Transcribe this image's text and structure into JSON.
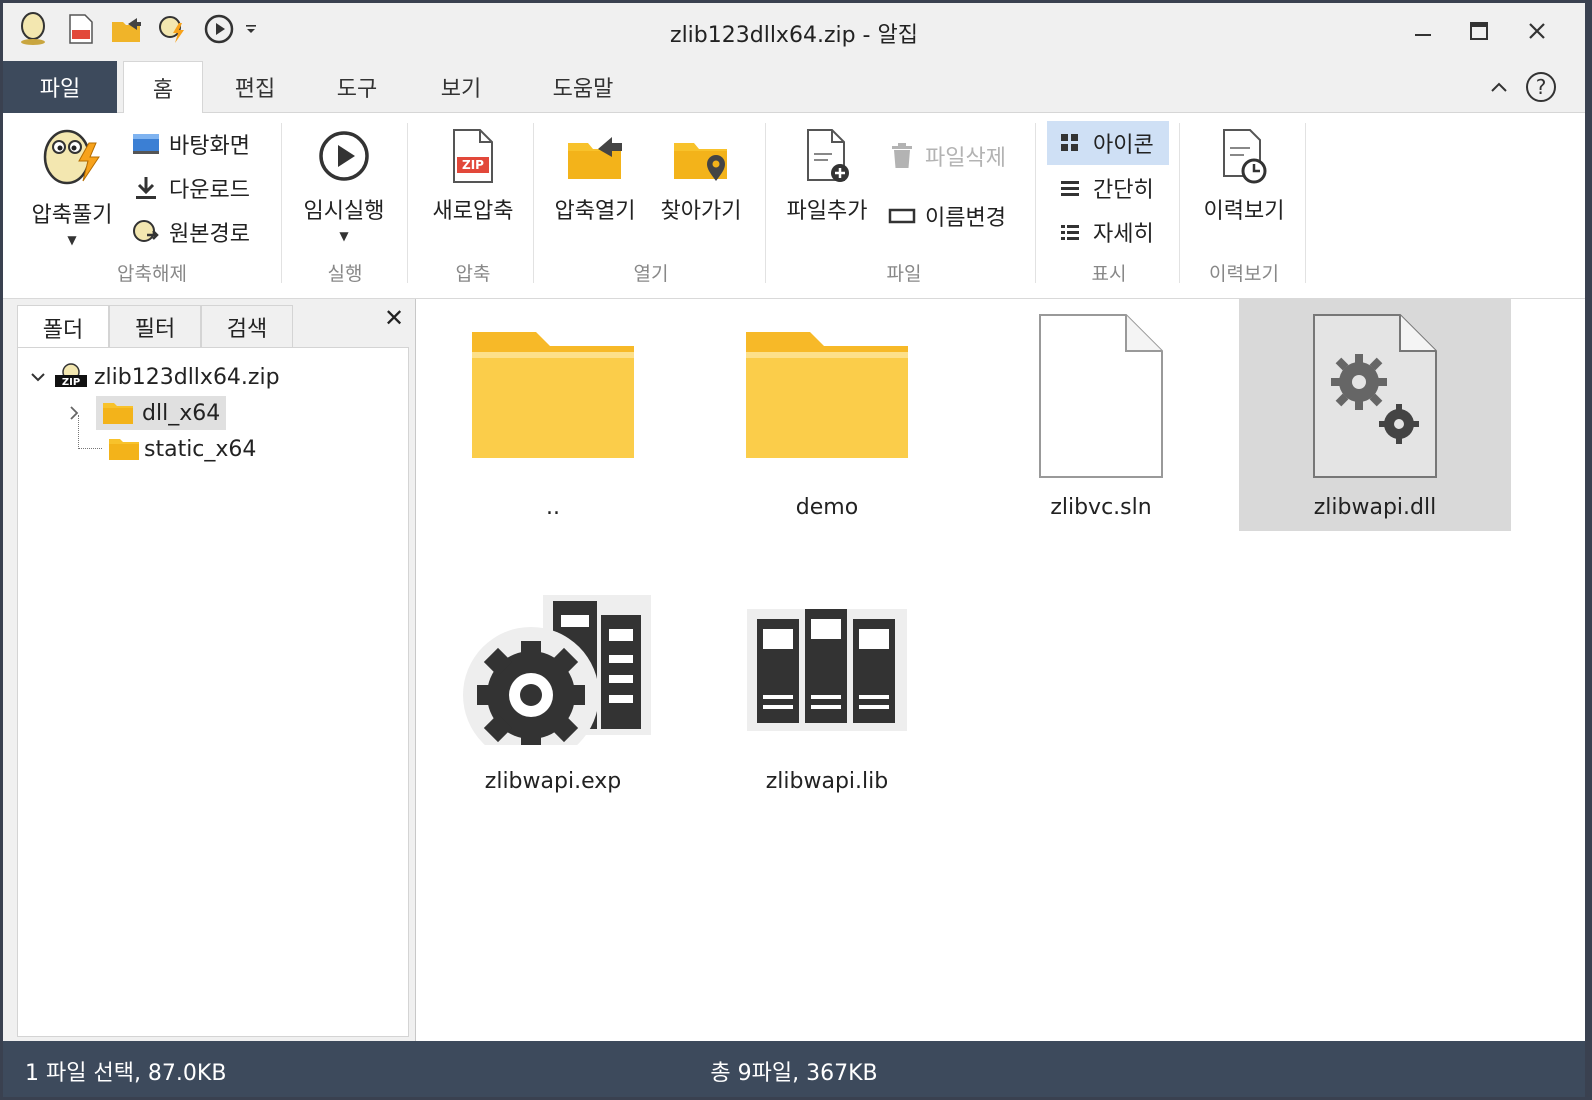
{
  "window": {
    "title": "zlib123dllx64.zip - 알집"
  },
  "tabs": [
    {
      "label": "파일"
    },
    {
      "label": "홈"
    },
    {
      "label": "편집"
    },
    {
      "label": "도구"
    },
    {
      "label": "보기"
    },
    {
      "label": "도움말"
    }
  ],
  "ribbon": {
    "extract": {
      "big": "압축풀기",
      "desktop": "바탕화면",
      "download": "다운로드",
      "origin": "원본경로",
      "group": "압축해제"
    },
    "run": {
      "big": "임시실행",
      "group": "실행"
    },
    "compress": {
      "big": "새로압축",
      "group": "압축"
    },
    "open": {
      "open_label": "압축열기",
      "find_label": "찾아가기",
      "group": "열기"
    },
    "file": {
      "add": "파일추가",
      "delete": "파일삭제",
      "rename": "이름변경",
      "group": "파일"
    },
    "view": {
      "icon": "아이콘",
      "simple": "간단히",
      "detail": "자세히",
      "group": "표시"
    },
    "history": {
      "big": "이력보기",
      "group": "이력보기"
    },
    "zip_badge": "ZIP"
  },
  "left_pane": {
    "tabs": [
      {
        "label": "폴더"
      },
      {
        "label": "필터"
      },
      {
        "label": "검색"
      }
    ],
    "close": "✕",
    "tree": {
      "root": "zlib123dllx64.zip",
      "children": [
        {
          "label": "dll_x64"
        },
        {
          "label": "static_x64"
        }
      ]
    }
  },
  "files": [
    {
      "name": "..",
      "icon": "folder-icon"
    },
    {
      "name": "demo",
      "icon": "folder-icon"
    },
    {
      "name": "zlibvc.sln",
      "icon": "blank-document-icon"
    },
    {
      "name": "zlibwapi.dll",
      "icon": "dll-gear-document-icon",
      "selected": true
    },
    {
      "name": "zlibwapi.exp",
      "icon": "gear-server-icon"
    },
    {
      "name": "zlibwapi.lib",
      "icon": "library-books-icon"
    }
  ],
  "status": {
    "left": "1 파일 선택,  87.0KB",
    "center": "총 9파일,  367KB"
  },
  "colors": {
    "dark": "#3d4a5c",
    "folder": "#f8c22b",
    "selection": "#d9d9d9",
    "view_selected": "#cfe0f5"
  }
}
